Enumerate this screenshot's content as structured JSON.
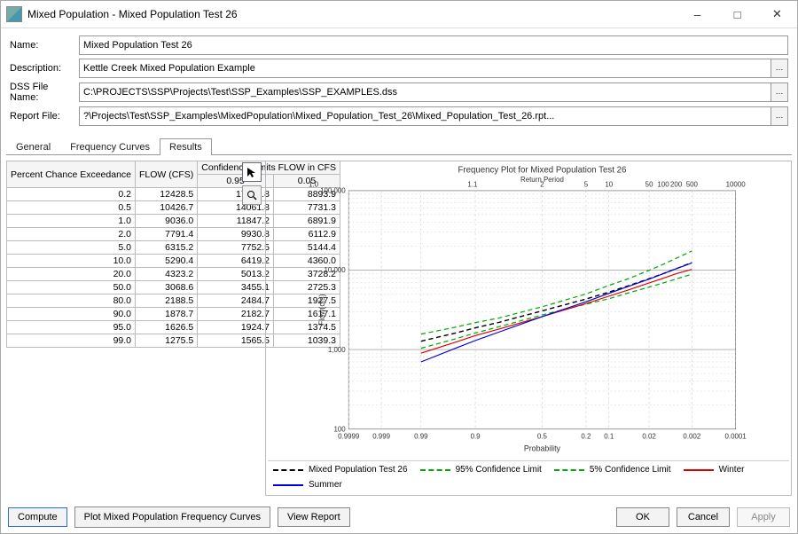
{
  "window_title": "Mixed Population - Mixed Population Test 26",
  "fields": {
    "name_label": "Name:",
    "name_value": "Mixed Population Test 26",
    "desc_label": "Description:",
    "desc_value": "Kettle Creek Mixed Population Example",
    "dss_label": "DSS File Name:",
    "dss_value": "C:\\PROJECTS\\SSP\\Projects\\Test\\SSP_Examples\\SSP_EXAMPLES.dss",
    "rpt_label": "Report File:",
    "rpt_value": "?\\Projects\\Test\\SSP_Examples\\MixedPopulation\\Mixed_Population_Test_26\\Mixed_Population_Test_26.rpt..."
  },
  "tabs": {
    "general": "General",
    "freq": "Frequency Curves",
    "results": "Results"
  },
  "table": {
    "h1": "Percent Chance Exceedance",
    "h2": "FLOW (CFS)",
    "h3": "Confidence Limits FLOW in CFS",
    "h3a": "0.95",
    "h3b": "0.05",
    "rows": [
      {
        "p": "0.2",
        "f": "12428.5",
        "lo": "17367.8",
        "hi": "8893.9"
      },
      {
        "p": "0.5",
        "f": "10426.7",
        "lo": "14061.8",
        "hi": "7731.3"
      },
      {
        "p": "1.0",
        "f": "9036.0",
        "lo": "11847.2",
        "hi": "6891.9"
      },
      {
        "p": "2.0",
        "f": "7791.4",
        "lo": "9930.8",
        "hi": "6112.9"
      },
      {
        "p": "5.0",
        "f": "6315.2",
        "lo": "7752.5",
        "hi": "5144.4"
      },
      {
        "p": "10.0",
        "f": "5290.4",
        "lo": "6419.2",
        "hi": "4360.0"
      },
      {
        "p": "20.0",
        "f": "4323.2",
        "lo": "5013.2",
        "hi": "3728.2"
      },
      {
        "p": "50.0",
        "f": "3068.6",
        "lo": "3455.1",
        "hi": "2725.3"
      },
      {
        "p": "80.0",
        "f": "2188.5",
        "lo": "2484.7",
        "hi": "1927.5"
      },
      {
        "p": "90.0",
        "f": "1878.7",
        "lo": "2182.7",
        "hi": "1617.1"
      },
      {
        "p": "95.0",
        "f": "1626.5",
        "lo": "1924.7",
        "hi": "1374.5"
      },
      {
        "p": "99.0",
        "f": "1275.5",
        "lo": "1565.5",
        "hi": "1039.3"
      }
    ]
  },
  "chart": {
    "title": "Frequency Plot for Mixed Population Test 26",
    "xlabel": "Probability",
    "ylabel": "Flow(cfs)",
    "top_label": "Return Period",
    "x_ticks": [
      "0.9999",
      "0.999",
      "0.99",
      "0.9",
      "0.5",
      "0.2",
      "0.1",
      "0.02",
      "0.002",
      "0.0001"
    ],
    "rp_ticks": [
      "1.0",
      "1.1",
      "2",
      "5",
      "10",
      "50",
      "100",
      "200",
      "500",
      "10000"
    ],
    "y_ticks": [
      "100",
      "1,000",
      "10,000",
      "100,000"
    ]
  },
  "legend": {
    "main": "Mixed Population Test 26",
    "cl95": "95% Confidence Limit",
    "cl5": "5% Confidence Limit",
    "winter": "Winter",
    "summer": "Summer"
  },
  "buttons": {
    "compute": "Compute",
    "plot": "Plot Mixed Population Frequency Curves",
    "view": "View Report",
    "ok": "OK",
    "cancel": "Cancel",
    "apply": "Apply"
  },
  "chart_data": {
    "type": "line",
    "title": "Frequency Plot for Mixed Population Test 26",
    "xlabel": "Probability",
    "ylabel": "Flow (cfs)",
    "x_probability": [
      0.99,
      0.95,
      0.9,
      0.8,
      0.5,
      0.2,
      0.1,
      0.05,
      0.02,
      0.01,
      0.005,
      0.002
    ],
    "series": [
      {
        "name": "Mixed Population Test 26",
        "style": "black-dash",
        "values": [
          1275.5,
          1626.5,
          1878.7,
          2188.5,
          3068.6,
          4323.2,
          5290.4,
          6315.2,
          7791.4,
          9036.0,
          10426.7,
          12428.5
        ]
      },
      {
        "name": "95% Confidence Limit",
        "style": "green-dash",
        "values": [
          1565.5,
          1924.7,
          2182.7,
          2484.7,
          3455.1,
          5013.2,
          6419.2,
          7752.5,
          9930.8,
          11847.2,
          14061.8,
          17367.8
        ]
      },
      {
        "name": "5% Confidence Limit",
        "style": "green-dash",
        "values": [
          1039.3,
          1374.5,
          1617.1,
          1927.5,
          2725.3,
          3728.2,
          4360.0,
          5144.4,
          6112.9,
          6891.9,
          7731.3,
          8893.9
        ]
      },
      {
        "name": "Winter",
        "style": "red-solid",
        "values": [
          900,
          1250,
          1500,
          1800,
          2600,
          3800,
          4700,
          5600,
          6900,
          7900,
          9000,
          10200
        ]
      },
      {
        "name": "Summer",
        "style": "blue-solid",
        "values": [
          700,
          1050,
          1300,
          1650,
          2600,
          4000,
          5100,
          6200,
          7700,
          9000,
          10400,
          12300
        ]
      }
    ],
    "ylim": [
      100,
      100000
    ]
  }
}
